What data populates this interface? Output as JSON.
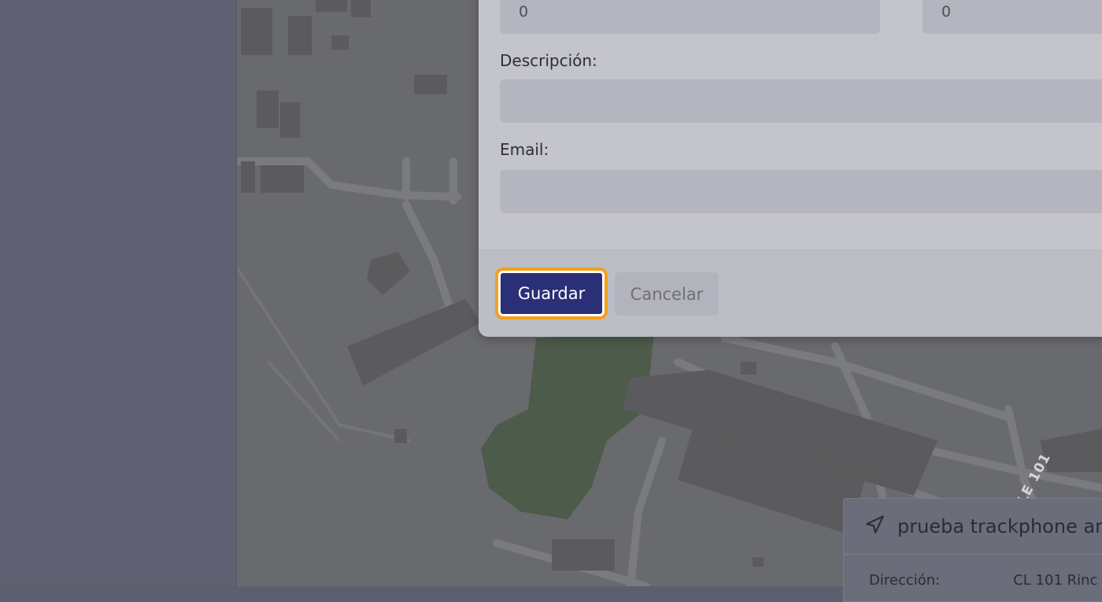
{
  "form": {
    "field_left_value": "0",
    "field_right_value": "0",
    "descripcion_label": "Descripción:",
    "descripcion_value": "",
    "email_label": "Email:",
    "email_value": ""
  },
  "buttons": {
    "save": "Guardar",
    "cancel": "Cancelar"
  },
  "map": {
    "street_label": "LE 101"
  },
  "device_card": {
    "icon": "navigation-arrow-icon",
    "title": "prueba trackphone an",
    "address_label": "Dirección:",
    "address_value": "CL 101  Rinc"
  }
}
